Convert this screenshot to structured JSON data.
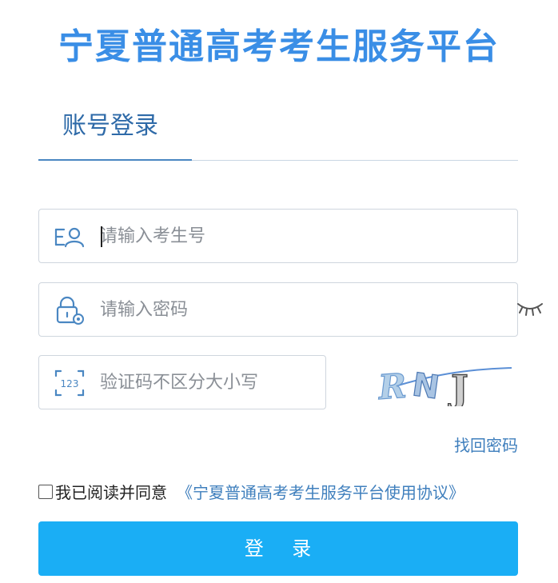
{
  "header": {
    "title": "宁夏普通高考考生服务平台"
  },
  "tabs": [
    {
      "label": "账号登录",
      "active": true
    }
  ],
  "form": {
    "username": {
      "placeholder": "请输入考生号",
      "value": "",
      "icon": "user-id-icon"
    },
    "password": {
      "placeholder": "请输入密码",
      "value": "",
      "icon": "lock-gear-icon",
      "toggle_icon": "eye-closed-icon"
    },
    "captcha": {
      "placeholder": "验证码不区分大小写",
      "value": "",
      "icon": "number-123-icon",
      "image_text": "RNJ"
    },
    "forgot_link": "找回密码",
    "agree": {
      "checked": false,
      "text": "我已阅读并同意",
      "link": "《宁夏普通高考考生服务平台使用协议》"
    },
    "submit_label": "登    录"
  },
  "colors": {
    "title": "#3a8ee6",
    "tab_text": "#2e6aa8",
    "link": "#3f7fbd",
    "button_bg": "#1aaef5",
    "button_text": "#ffffff",
    "input_border": "#cfd6de"
  }
}
